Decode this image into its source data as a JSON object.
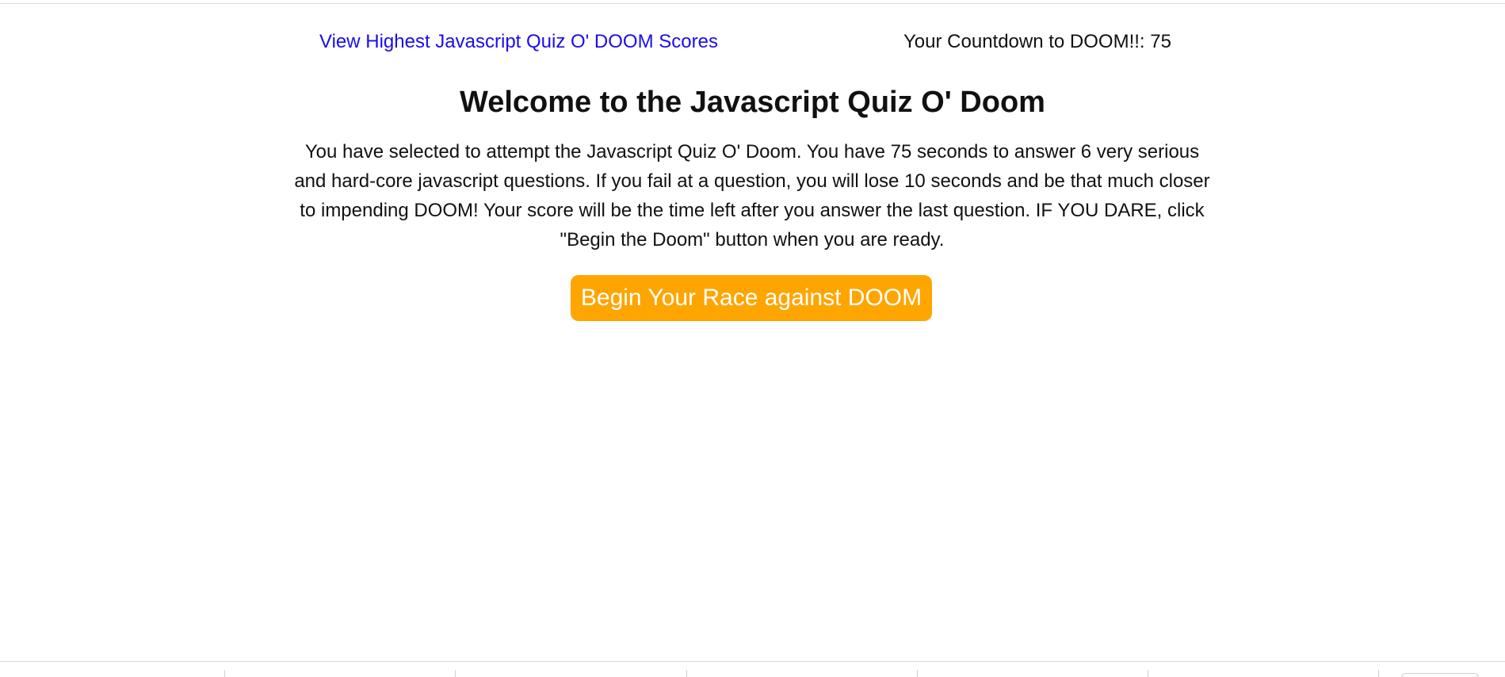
{
  "header": {
    "scores_link_label": "View Highest Javascript Quiz O' DOOM Scores",
    "countdown_text": "Your Countdown to DOOM!!: 75"
  },
  "main": {
    "title": "Welcome to the Javascript Quiz O' Doom",
    "intro": "You have selected to attempt the Javascript Quiz O' Doom. You have 75 seconds to answer 6 very serious and hard-core javascript questions. If you fail at a question, you will lose 10 seconds and be that much closer to impending DOOM! Your score will be the time left after you answer the last question. IF YOU DARE, click \"Begin the Doom\" button when you are ready.",
    "begin_button_label": "Begin Your Race against DOOM"
  },
  "colors": {
    "link": "#1a0dea",
    "button_background": "#ffa500",
    "button_text": "#ffffff"
  }
}
